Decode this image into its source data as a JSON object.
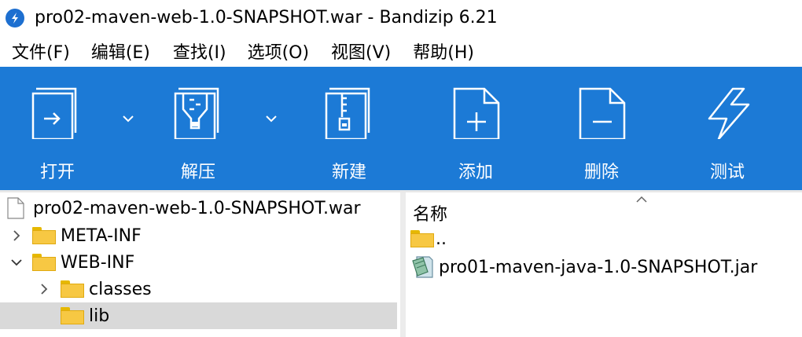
{
  "window": {
    "title": "pro02-maven-web-1.0-SNAPSHOT.war - Bandizip 6.21"
  },
  "menu": [
    {
      "label": "文件(F)"
    },
    {
      "label": "编辑(E)"
    },
    {
      "label": "查找(I)"
    },
    {
      "label": "选项(O)"
    },
    {
      "label": "视图(V)"
    },
    {
      "label": "帮助(H)"
    }
  ],
  "toolbar": {
    "open_label": "打开",
    "extract_label": "解压",
    "new_label": "新建",
    "add_label": "添加",
    "delete_label": "删除",
    "test_label": "测试"
  },
  "tree": {
    "root": "pro02-maven-web-1.0-SNAPSHOT.war",
    "items": [
      {
        "label": "META-INF",
        "state": "collapsed"
      },
      {
        "label": "WEB-INF",
        "state": "expanded"
      },
      {
        "label": "classes",
        "state": "collapsed"
      },
      {
        "label": "lib",
        "state": "selected"
      }
    ]
  },
  "file_list": {
    "column_name": "名称",
    "rows": [
      {
        "name": "..",
        "icon": "folder-icon"
      },
      {
        "name": "pro01-maven-java-1.0-SNAPSHOT.jar",
        "icon": "jar-file-icon"
      }
    ]
  },
  "colors": {
    "toolbar_bg": "#1c7ad6",
    "selection_bg": "#d9d9d9",
    "folder": "#f7c843"
  }
}
